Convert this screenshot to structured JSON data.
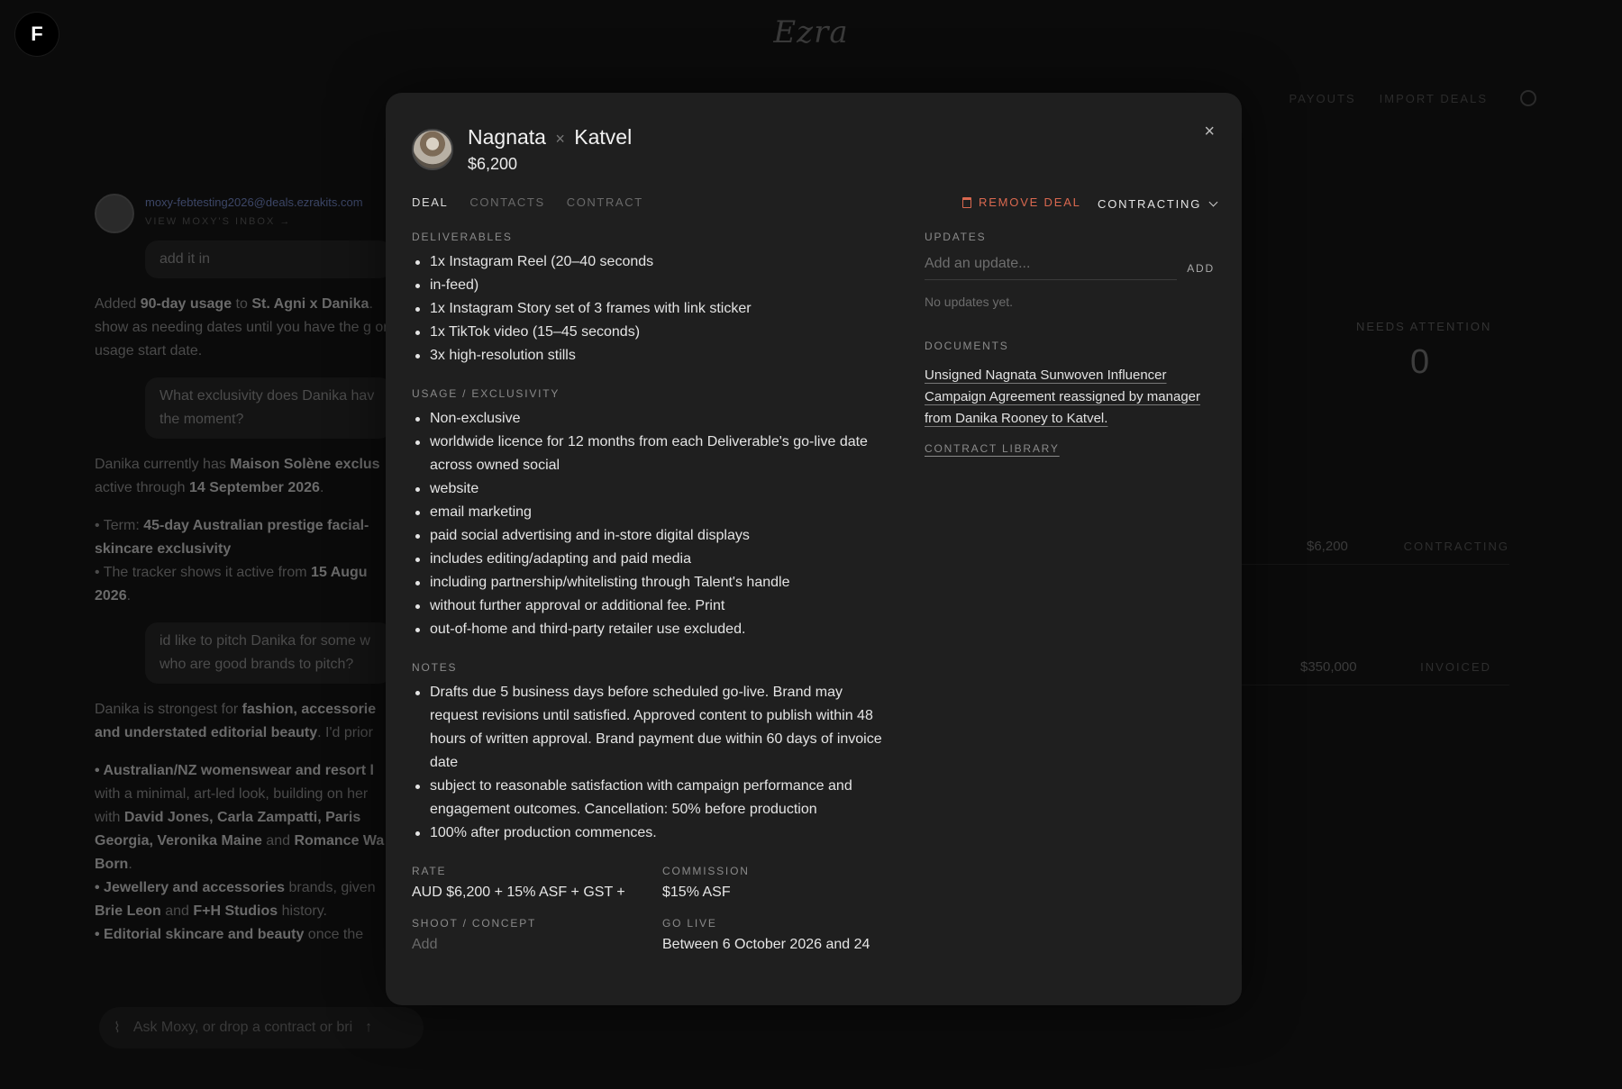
{
  "app": {
    "user_initial": "F",
    "brand": "Ezra",
    "nav": [
      "PAYOUTS",
      "IMPORT DEALS"
    ]
  },
  "chat": {
    "email": "moxy-febtesting2026@deals.ezrakits.com",
    "inbox_link": "VIEW MOXY'S INBOX →",
    "msg_add": "add it in",
    "reply1_a": "Added ",
    "reply1_b": "90-day usage",
    "reply1_c": " to ",
    "reply1_d": "St. Agni x Danika",
    "reply1_e": ". show as needing dates until you have the g or usage start date.",
    "msg_excl": "What exclusivity does Danika hav the moment?",
    "reply2_a": "Danika currently has ",
    "reply2_b": "Maison Solène exclus",
    "reply2_c": " active through ",
    "reply2_d": "14 September 2026",
    "reply2_e": ".",
    "term_a": "• Term: ",
    "term_b": "45-day Australian prestige facial-skincare exclusivity",
    "tracker_a": "• The tracker shows it active from ",
    "tracker_b": "15 Augu 2026",
    "tracker_c": ".",
    "msg_pitch": "id like to pitch Danika for some w who are good brands to pitch?",
    "reply3_a": "Danika is strongest for ",
    "reply3_b": "fashion, accessorie and understated editorial beauty",
    "reply3_c": ". I'd prior",
    "b1_a": "• Australian/NZ womenswear and resort l",
    "b1_b": " with a minimal, art-led look, building on her with ",
    "b1_c": "David Jones, Carla Zampatti, Paris Georgia, Veronika Maine",
    "b1_d": " and ",
    "b1_e": "Romance Wa Born",
    "b1_f": ".",
    "b2_a": "• Jewellery and accessories",
    "b2_b": " brands, given ",
    "b2_c": "Brie Leon",
    "b2_d": " and ",
    "b2_e": "F+H Studios",
    "b2_f": " history.",
    "b3_a": "• Editorial skincare and beauty",
    "b3_b": " once the",
    "input_placeholder": "Ask Moxy, or drop a contract or bri"
  },
  "background_dashboard": {
    "needs_attention_label": "NEEDS ATTENTION",
    "needs_attention_value": "0",
    "rows": [
      {
        "amount": "$6,200",
        "status": "CONTRACTING"
      },
      {
        "amount": "$350,000",
        "status": "INVOICED"
      }
    ]
  },
  "modal": {
    "talent": "Nagnata",
    "separator": "×",
    "brand": "Katvel",
    "amount": "$6,200",
    "close": "×",
    "tabs": [
      "DEAL",
      "CONTACTS",
      "CONTRACT"
    ],
    "remove_label": "REMOVE DEAL",
    "status": "CONTRACTING",
    "deliverables_label": "DELIVERABLES",
    "deliverables": [
      "1x Instagram Reel (20–40 seconds",
      "in-feed)",
      "1x Instagram Story set of 3 frames with link sticker",
      "1x TikTok video (15–45 seconds)",
      "3x high-resolution stills"
    ],
    "usage_label": "USAGE / EXCLUSIVITY",
    "usage": [
      "Non-exclusive",
      "worldwide licence for 12 months from each Deliverable's go-live date across owned social",
      "website",
      "email marketing",
      "paid social advertising and in-store digital displays",
      "includes editing/adapting and paid media",
      "including partnership/whitelisting through Talent's handle",
      "without further approval or additional fee. Print",
      "out-of-home and third-party retailer use excluded."
    ],
    "notes_label": "NOTES",
    "notes": [
      "Drafts due 5 business days before scheduled go-live. Brand may request revisions until satisfied. Approved content to publish within 48 hours of written approval. Brand payment due within 60 days of invoice date",
      "subject to reasonable satisfaction with campaign performance and engagement outcomes. Cancellation: 50% before production",
      "100% after production commences."
    ],
    "rate_label": "RATE",
    "rate_value": "AUD $6,200 + 15% ASF + GST +",
    "commission_label": "COMMISSION",
    "commission_value": "$15% ASF",
    "shoot_label": "SHOOT / CONCEPT",
    "shoot_placeholder": "Add",
    "golive_label": "GO LIVE",
    "golive_value": "Between 6 October 2026 and 24",
    "updates_label": "UPDATES",
    "update_placeholder": "Add an update...",
    "add_label": "ADD",
    "no_updates": "No updates yet.",
    "documents_label": "DOCUMENTS",
    "document_link": "Unsigned Nagnata Sunwoven Influencer Campaign Agreement reassigned by manager from Danika Rooney to Katvel.",
    "library_label": "CONTRACT LIBRARY"
  }
}
